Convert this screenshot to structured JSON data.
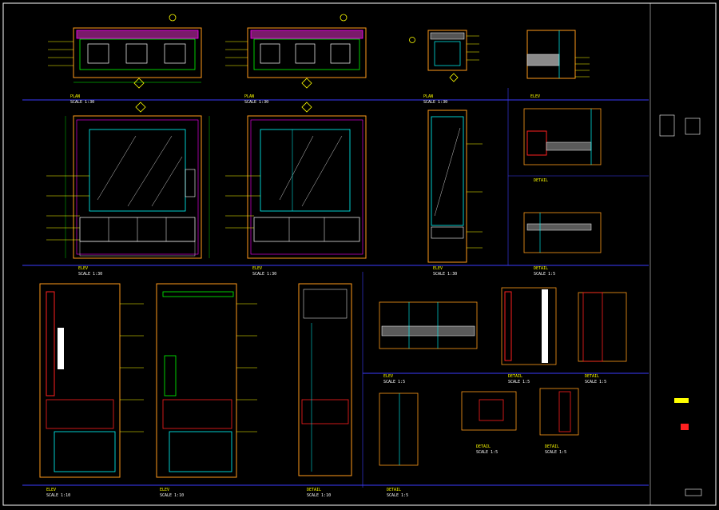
{
  "drawing": {
    "colors": {
      "background": "#000000",
      "frame": "#ffffff",
      "title_line": "#3c3cff",
      "wall_orange": "#ff9a1a",
      "dim_green": "#00ff00",
      "cyan": "#00ffff",
      "yellow": "#ffff00",
      "magenta": "#ff00ff",
      "red": "#ff2020"
    },
    "views": {
      "v1": {
        "title": "PLAN",
        "scale": "SCALE 1:30"
      },
      "v2": {
        "title": "PLAN",
        "scale": "SCALE 1:30"
      },
      "v3": {
        "title": "PLAN",
        "scale": "SCALE 1:30"
      },
      "v4": {
        "title": "ELEV",
        "scale": ""
      },
      "v5": {
        "title": "ELEV",
        "scale": "SCALE 1:30"
      },
      "v6": {
        "title": "ELEV",
        "scale": "SCALE 1:30"
      },
      "v7": {
        "title": "ELEV",
        "scale": "SCALE 1:30"
      },
      "v8": {
        "title": "DETAIL",
        "scale": ""
      },
      "v9": {
        "title": "DETAIL",
        "scale": "SCALE 1:5"
      },
      "v10": {
        "title": "ELEV",
        "scale": "SCALE 1:10"
      },
      "v11": {
        "title": "ELEV",
        "scale": "SCALE 1:10"
      },
      "v12": {
        "title": "DETAIL",
        "scale": "SCALE 1:10"
      },
      "v13": {
        "title": "ELEV",
        "scale": "SCALE 1:5"
      },
      "v14": {
        "title": "DETAIL",
        "scale": "SCALE 1:5"
      },
      "v15": {
        "title": "DETAIL",
        "scale": "SCALE 1:5"
      },
      "v16": {
        "title": "DETAIL",
        "scale": "SCALE 1:5"
      },
      "v17": {
        "title": "DETAIL",
        "scale": "SCALE 1:5"
      },
      "v18": {
        "title": "DETAIL",
        "scale": "SCALE 1:5"
      }
    }
  }
}
